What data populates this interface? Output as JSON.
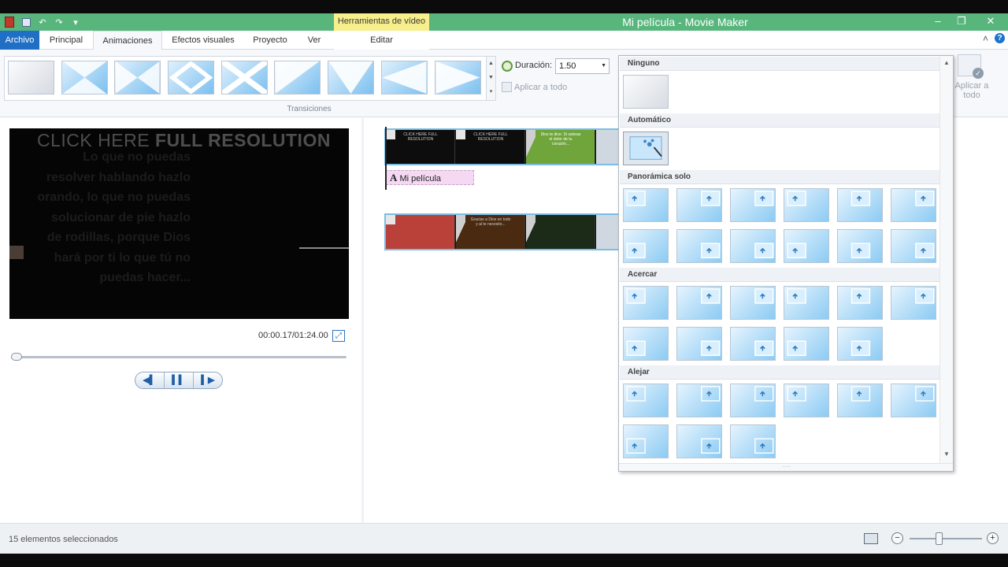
{
  "window": {
    "title": "Mi película - Movie Maker",
    "context_tab_group": "Herramientas de vídeo",
    "controls": [
      "–",
      "❐",
      "✕"
    ]
  },
  "quick_access": [
    "save",
    "undo",
    "redo",
    "customize"
  ],
  "tabs": [
    {
      "label": "Archivo"
    },
    {
      "label": "Principal"
    },
    {
      "label": "Animaciones"
    },
    {
      "label": "Efectos visuales"
    },
    {
      "label": "Proyecto"
    },
    {
      "label": "Ver"
    },
    {
      "label": "Editar"
    }
  ],
  "ribbon": {
    "group_label": "Transiciones",
    "duration_label": "Duración:",
    "duration_value": "1.50",
    "apply_all_label": "Aplicar a todo",
    "apply_all_big_label": "Aplicar a todo"
  },
  "preview": {
    "video_caption_prefix": "CLICK HERE ",
    "video_caption_bold": "FULL RESOLUTION",
    "video_overlay_text": "Lo que no puedas resolver hablando hazlo orando, lo que no puedas solucionar de pie hazlo de rodillas, porque Dios hará por ti lo que tú no puedas hacer...",
    "timecode": "00:00.17/01:24.00",
    "seek_position": 0.0,
    "buttons": {
      "prev": "◀▍",
      "pause": "▍▍",
      "next": "▍▶"
    }
  },
  "storyboard": {
    "caption_label": "Mi película",
    "row1_frames": [
      "CLICK HERE FULL RESOLUTION",
      "CLICK HERE FULL RESOLUTION",
      "Dios te dice: Si valoras el dolor de tu corazón...",
      ""
    ],
    "row2_frames": [
      "",
      "Gracias a Dios en todo y al te necesito...",
      "",
      ""
    ]
  },
  "gallery": {
    "sections": [
      {
        "title": "Ninguno"
      },
      {
        "title": "Automático"
      },
      {
        "title": "Panorámica solo"
      },
      {
        "title": "Acercar"
      },
      {
        "title": "Alejar"
      }
    ]
  },
  "status": {
    "text": "15 elementos seleccionados",
    "zoom_level": 0.38
  },
  "colors": {
    "titlebar": "#58b67d",
    "file_tab": "#1f6fc5",
    "context_tab": "#f7ee8c",
    "accent_blue": "#7bbde6"
  }
}
